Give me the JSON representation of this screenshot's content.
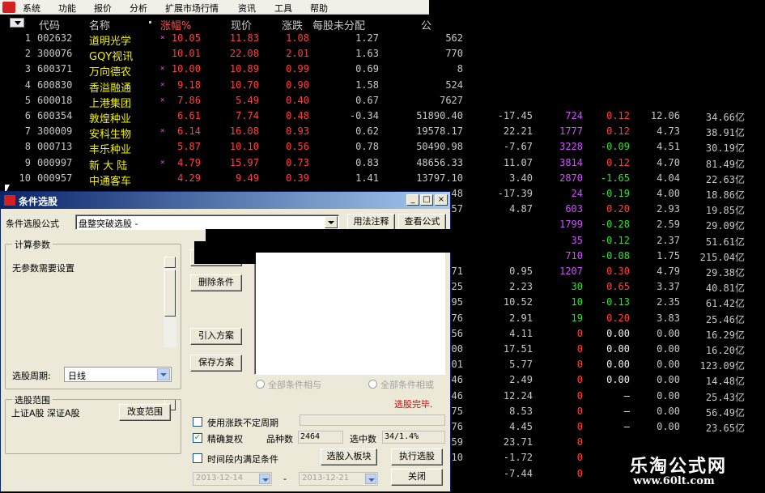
{
  "menu": [
    "系统",
    "功能",
    "报价",
    "分析",
    "扩展市场行情",
    "资讯",
    "工具",
    "帮助"
  ],
  "header": {
    "code": "代码",
    "name": "名称",
    "chg_pct": "涨幅%",
    "price": "现价",
    "change": "涨跌",
    "eps": "每股未分配",
    "last": "公"
  },
  "rows": [
    {
      "no": "1",
      "code": "002632",
      "name": "道明光学",
      "mk": "×",
      "chg": "10.05",
      "price": "11.83",
      "diff": "1.08",
      "eps": "1.27",
      "x": "562",
      "y": "",
      "z": "",
      "w": "",
      "v": "",
      "u": ""
    },
    {
      "no": "2",
      "code": "300076",
      "name": "GQY视讯",
      "mk": "",
      "chg": "10.01",
      "price": "22.08",
      "diff": "2.01",
      "eps": "1.63",
      "x": "770",
      "y": "",
      "z": "",
      "w": "",
      "v": "",
      "u": ""
    },
    {
      "no": "3",
      "code": "600371",
      "name": "万向德农",
      "mk": "×",
      "chg": "10.00",
      "price": "10.89",
      "diff": "0.99",
      "eps": "0.69",
      "x": "8",
      "y": "",
      "z": "",
      "w": "",
      "v": "",
      "u": ""
    },
    {
      "no": "4",
      "code": "600830",
      "name": "香溢融通",
      "mk": "×",
      "chg": "9.18",
      "price": "10.70",
      "diff": "0.90",
      "eps": "1.58",
      "x": "524",
      "y": "",
      "z": "",
      "w": "",
      "v": "",
      "u": ""
    },
    {
      "no": "5",
      "code": "600018",
      "name": "上港集团",
      "mk": "×",
      "chg": "7.86",
      "price": "5.49",
      "diff": "0.40",
      "eps": "0.67",
      "x": "7627",
      "y": "",
      "z": "",
      "w": "",
      "v": "",
      "u": ""
    },
    {
      "no": "6",
      "code": "600354",
      "name": "敦煌种业",
      "mk": "",
      "chg": "6.61",
      "price": "7.74",
      "diff": "0.48",
      "eps": "-0.34",
      "x": "51890.40",
      "y": "-17.45",
      "z": "724",
      "w": "0.12",
      "v": "12.06",
      "u": "34.66亿"
    },
    {
      "no": "7",
      "code": "300009",
      "name": "安科生物",
      "mk": "×",
      "chg": "6.14",
      "price": "16.08",
      "diff": "0.93",
      "eps": "0.62",
      "x": "19578.17",
      "y": "22.21",
      "z": "1777",
      "w": "0.12",
      "v": "4.73",
      "u": "38.91亿"
    },
    {
      "no": "8",
      "code": "000713",
      "name": "丰乐种业",
      "mk": "",
      "chg": "5.87",
      "price": "10.10",
      "diff": "0.56",
      "eps": "0.78",
      "x": "50490.98",
      "y": "-7.67",
      "z": "3228",
      "w": "-0.09",
      "v": "4.51",
      "u": "30.19亿"
    },
    {
      "no": "9",
      "code": "000997",
      "name": "新 大 陆",
      "mk": "×",
      "chg": "4.79",
      "price": "15.97",
      "diff": "0.73",
      "eps": "0.83",
      "x": "48656.33",
      "y": "11.07",
      "z": "3814",
      "w": "0.12",
      "v": "4.70",
      "u": "81.49亿"
    },
    {
      "no": "10",
      "code": "000957",
      "name": "中通客车",
      "mk": "",
      "chg": "4.29",
      "price": "9.49",
      "diff": "0.39",
      "eps": "1.41",
      "x": "13797.10",
      "y": "3.40",
      "z": "2870",
      "w": "-1.65",
      "v": "4.04",
      "u": "22.63亿"
    },
    {
      "no": "",
      "code": "",
      "name": "",
      "mk": "",
      "chg": "",
      "price": "",
      "diff": "",
      "eps": "",
      "x": "48",
      "y": "-17.39",
      "z": "24",
      "w": "-0.19",
      "v": "4.00",
      "u": "18.86亿"
    },
    {
      "no": "",
      "code": "",
      "name": "",
      "mk": "",
      "chg": "",
      "price": "",
      "diff": "",
      "eps": "",
      "x": "57",
      "y": "4.87",
      "z": "603",
      "w": "0.20",
      "v": "2.93",
      "u": "19.85亿"
    },
    {
      "no": "",
      "code": "",
      "name": "",
      "mk": "",
      "chg": "",
      "price": "",
      "diff": "",
      "eps": "",
      "x": "",
      "y": "",
      "z": "1799",
      "w": "-0.28",
      "v": "2.59",
      "u": "29.09亿"
    },
    {
      "no": "",
      "code": "",
      "name": "",
      "mk": "",
      "chg": "",
      "price": "",
      "diff": "",
      "eps": "",
      "x": "",
      "y": "",
      "z": "35",
      "w": "-0.12",
      "v": "2.37",
      "u": "51.61亿"
    },
    {
      "no": "",
      "code": "",
      "name": "",
      "mk": "",
      "chg": "",
      "price": "",
      "diff": "",
      "eps": "",
      "x": "",
      "y": "",
      "z": "710",
      "w": "-0.08",
      "v": "1.75",
      "u": "215.04亿"
    },
    {
      "no": "",
      "code": "",
      "name": "",
      "mk": "",
      "chg": "",
      "price": "",
      "diff": "",
      "eps": "",
      "x": "71",
      "y": "0.95",
      "z": "1207",
      "w": "0.30",
      "v": "4.79",
      "u": "29.38亿"
    },
    {
      "no": "",
      "code": "",
      "name": "",
      "mk": "",
      "chg": "",
      "price": "",
      "diff": "",
      "eps": "",
      "x": "25",
      "y": "2.23",
      "z": "30",
      "w": "0.65",
      "v": "3.37",
      "u": "40.81亿"
    },
    {
      "no": "",
      "code": "",
      "name": "",
      "mk": "",
      "chg": "",
      "price": "",
      "diff": "",
      "eps": "",
      "x": "95",
      "y": "10.52",
      "z": "10",
      "w": "-0.13",
      "v": "2.35",
      "u": "61.42亿"
    },
    {
      "no": "",
      "code": "",
      "name": "",
      "mk": "",
      "chg": "",
      "price": "",
      "diff": "",
      "eps": "",
      "x": "76",
      "y": "2.91",
      "z": "19",
      "w": "0.20",
      "v": "3.83",
      "u": "25.46亿"
    },
    {
      "no": "",
      "code": "",
      "name": "",
      "mk": "",
      "chg": "",
      "price": "",
      "diff": "",
      "eps": "",
      "x": "56",
      "y": "4.11",
      "z": "0",
      "w": "0.00",
      "v": "0.00",
      "u": "16.29亿"
    },
    {
      "no": "",
      "code": "",
      "name": "",
      "mk": "",
      "chg": "",
      "price": "",
      "diff": "",
      "eps": "",
      "x": "00",
      "y": "17.51",
      "z": "0",
      "w": "0.00",
      "v": "0.00",
      "u": "16.20亿"
    },
    {
      "no": "",
      "code": "",
      "name": "",
      "mk": "",
      "chg": "",
      "price": "",
      "diff": "",
      "eps": "",
      "x": "01",
      "y": "5.77",
      "z": "0",
      "w": "0.00",
      "v": "0.00",
      "u": "123.09亿"
    },
    {
      "no": "",
      "code": "",
      "name": "",
      "mk": "",
      "chg": "",
      "price": "",
      "diff": "",
      "eps": "",
      "x": "46",
      "y": "2.49",
      "z": "0",
      "w": "0.00",
      "v": "0.00",
      "u": "14.48亿"
    },
    {
      "no": "",
      "code": "",
      "name": "",
      "mk": "",
      "chg": "",
      "price": "",
      "diff": "",
      "eps": "",
      "x": "46",
      "y": "12.24",
      "z": "0",
      "w": "—",
      "v": "0.00",
      "u": "25.43亿"
    },
    {
      "no": "",
      "code": "",
      "name": "",
      "mk": "",
      "chg": "",
      "price": "",
      "diff": "",
      "eps": "",
      "x": "75",
      "y": "8.53",
      "z": "0",
      "w": "—",
      "v": "0.00",
      "u": "56.49亿"
    },
    {
      "no": "",
      "code": "",
      "name": "",
      "mk": "",
      "chg": "",
      "price": "",
      "diff": "",
      "eps": "",
      "x": "76",
      "y": "4.45",
      "z": "0",
      "w": "—",
      "v": "0.00",
      "u": "23.65亿"
    },
    {
      "no": "",
      "code": "",
      "name": "",
      "mk": "",
      "chg": "",
      "price": "",
      "diff": "",
      "eps": "",
      "x": "59",
      "y": "23.71",
      "z": "0",
      "w": "",
      "v": "",
      "u": ""
    },
    {
      "no": "",
      "code": "",
      "name": "",
      "mk": "",
      "chg": "",
      "price": "",
      "diff": "",
      "eps": "",
      "x": "10",
      "y": "-1.72",
      "z": "0",
      "w": "",
      "v": "",
      "u": ""
    },
    {
      "no": "",
      "code": "",
      "name": "",
      "mk": "",
      "chg": "",
      "price": "",
      "diff": "",
      "eps": "",
      "x": "",
      "y": "-7.44",
      "z": "0",
      "w": "",
      "v": "",
      "u": ""
    }
  ],
  "dialog": {
    "title": "条件选股",
    "formula_label": "条件选股公式",
    "formula_value": "盘整突破选股 -",
    "usage_btn": "用法注释",
    "view_btn": "查看公式",
    "params_group": "计算参数",
    "params_text": "无参数需要设置",
    "add_btn": "加",
    "delete_btn": "删除条件",
    "import_btn": "引入方案",
    "save_btn": "保存方案",
    "period_label": "选股周期:",
    "period_value": "日线",
    "radio_and": "全部条件相与",
    "radio_or": "全部条件相或",
    "done_text": "选股完毕.",
    "range_group": "选股范围",
    "range_text": "上证A股 深证A股",
    "change_range_btn": "改变范围",
    "chk_period": "使用涨跌不定周期",
    "chk_adjust": "精确复权",
    "total_label": "品种数",
    "total_value": "2464",
    "selected_label": "选中数",
    "selected_value": "34/1.4%",
    "chk_time": "时间段内满足条件",
    "date_from": "2013-12-14",
    "date_sep": "-",
    "date_to": "2013-12-21",
    "to_board_btn": "选股入板块",
    "run_btn": "执行选股",
    "close_btn": "关闭"
  },
  "watermark": {
    "cn": "乐淘公式网",
    "url": "www.60lt.com"
  }
}
